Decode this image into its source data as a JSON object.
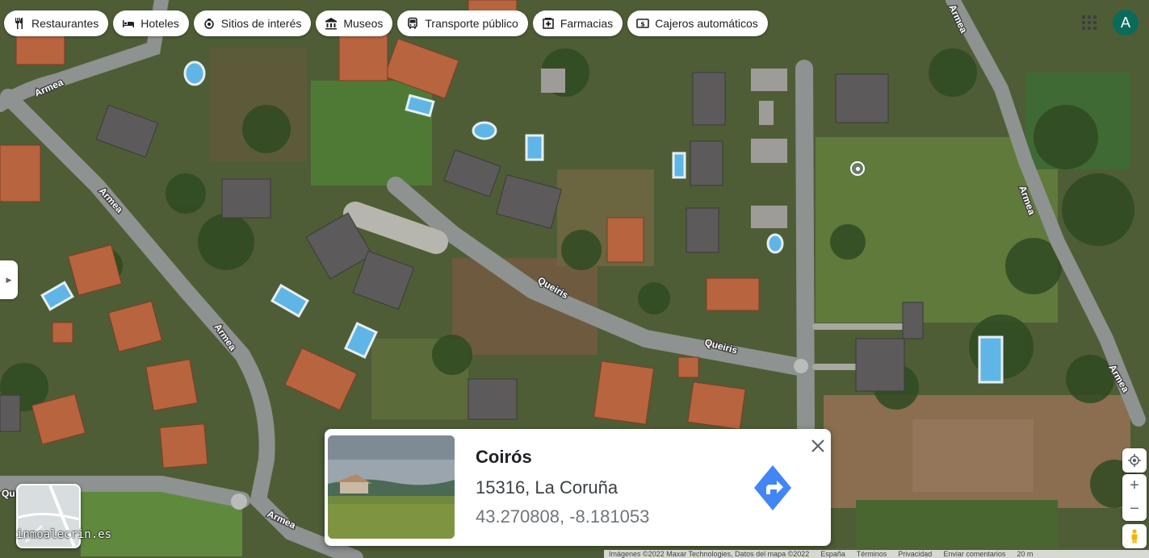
{
  "categories": [
    {
      "label": "Restaurantes",
      "icon": "fork-knife-icon"
    },
    {
      "label": "Hoteles",
      "icon": "bed-icon"
    },
    {
      "label": "Sitios de interés",
      "icon": "camera-icon"
    },
    {
      "label": "Museos",
      "icon": "museum-icon"
    },
    {
      "label": "Transporte público",
      "icon": "bus-icon"
    },
    {
      "label": "Farmacias",
      "icon": "pharmacy-icon"
    },
    {
      "label": "Cajeros automáticos",
      "icon": "atm-icon"
    }
  ],
  "account": {
    "initial": "A",
    "color": "#0b6b5b"
  },
  "streets": {
    "armea": "Armea",
    "queiris": "Queiris",
    "partial_left": "Qu"
  },
  "card": {
    "title": "Coirós",
    "address": "15316, La Coruña",
    "coordinates": "43.270808, -8.181053"
  },
  "watermark": "inmoalecrin.es",
  "controls": {
    "zoom_in": "+",
    "zoom_out": "−"
  },
  "footer": {
    "imagery": "Imágenes ©2022 Maxar Technologies, Datos del mapa ©2022",
    "country": "España",
    "terms": "Términos",
    "privacy": "Privacidad",
    "feedback": "Enviar comentarios",
    "scale": "20 m"
  },
  "colors": {
    "accent_blue": "#4285f4",
    "chip_bg": "#ffffff"
  }
}
